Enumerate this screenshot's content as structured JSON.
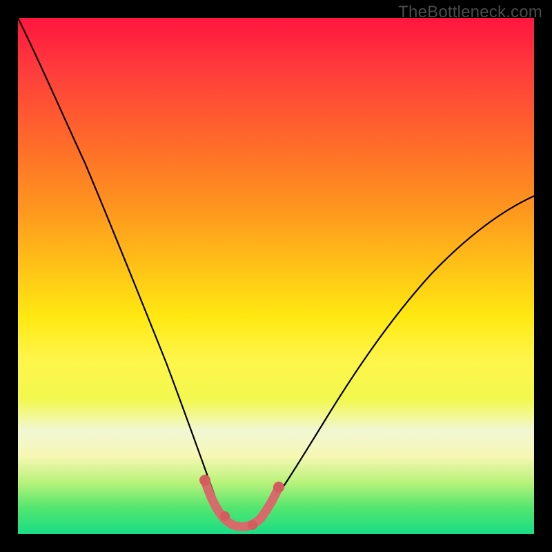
{
  "watermark": {
    "text": "TheBottleneck.com"
  },
  "colors": {
    "frame": "#000000",
    "curve": "#000000",
    "highlight": "#d76b6b",
    "highlight_dot": "#d45c5c"
  },
  "chart_data": {
    "type": "line",
    "title": "",
    "xlabel": "",
    "ylabel": "",
    "xlim": [
      0,
      100
    ],
    "ylim": [
      0,
      100
    ],
    "series": [
      {
        "name": "bottleneck-curve",
        "x": [
          0,
          5,
          10,
          15,
          20,
          25,
          30,
          34,
          37,
          39,
          41,
          43,
          46,
          50,
          55,
          60,
          65,
          70,
          75,
          80,
          85,
          90,
          95,
          100
        ],
        "y": [
          100,
          90,
          80,
          70,
          59,
          47,
          33,
          20,
          11,
          6,
          3,
          2,
          2,
          3,
          7,
          13,
          21,
          29,
          37,
          45,
          52,
          58,
          62,
          65
        ]
      }
    ],
    "highlight_region": {
      "x0": 37,
      "x1": 50,
      "approx_y": [
        11,
        6,
        3,
        2,
        2,
        3,
        7
      ]
    }
  }
}
